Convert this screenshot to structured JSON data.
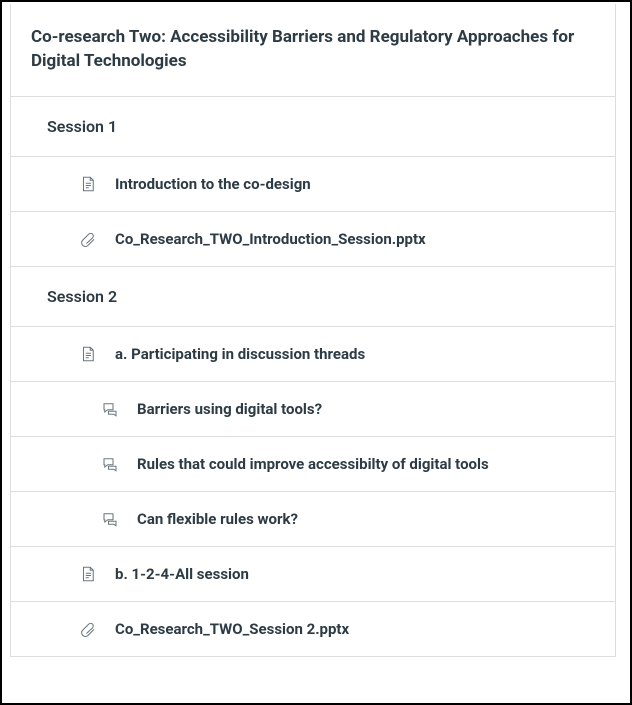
{
  "module": {
    "title": "Co-research Two: Accessibility Barriers and Regulatory Approaches for Digital Technologies"
  },
  "sessions": [
    {
      "label": "Session 1",
      "items": [
        {
          "type": "page",
          "label": "Introduction to the co-design"
        },
        {
          "type": "attachment",
          "label": "Co_Research_TWO_Introduction_Session.pptx"
        }
      ]
    },
    {
      "label": "Session 2",
      "items": [
        {
          "type": "page",
          "label": "a. Participating in discussion threads"
        },
        {
          "type": "discussion",
          "label": "Barriers using digital tools?",
          "indent": 2
        },
        {
          "type": "discussion",
          "label": "Rules that could improve accessibilty of digital tools",
          "indent": 2
        },
        {
          "type": "discussion",
          "label": "Can flexible rules work?",
          "indent": 2
        },
        {
          "type": "page",
          "label": "b. 1-2-4-All session"
        },
        {
          "type": "attachment",
          "label": "Co_Research_TWO_Session 2.pptx"
        }
      ]
    }
  ]
}
